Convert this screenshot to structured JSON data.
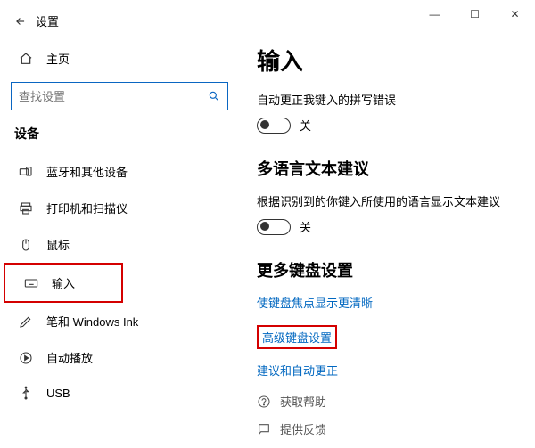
{
  "window": {
    "title": "设置",
    "controls": {
      "min": "—",
      "max": "☐",
      "close": "✕"
    }
  },
  "sidebar": {
    "home": "主页",
    "search_placeholder": "查找设置",
    "section": "设备",
    "items": [
      {
        "label": "蓝牙和其他设备"
      },
      {
        "label": "打印机和扫描仪"
      },
      {
        "label": "鼠标"
      },
      {
        "label": "输入"
      },
      {
        "label": "笔和 Windows Ink"
      },
      {
        "label": "自动播放"
      },
      {
        "label": "USB"
      }
    ]
  },
  "main": {
    "title": "输入",
    "autocorrect_desc": "自动更正我键入的拼写错误",
    "off1": "关",
    "multi_title": "多语言文本建议",
    "multi_desc": "根据识别到的你键入所使用的语言显示文本建议",
    "off2": "关",
    "more_title": "更多键盘设置",
    "link_focus": "使键盘焦点显示更清晰",
    "link_adv": "高级键盘设置",
    "link_suggest": "建议和自动更正",
    "help": "获取帮助",
    "feedback": "提供反馈"
  }
}
